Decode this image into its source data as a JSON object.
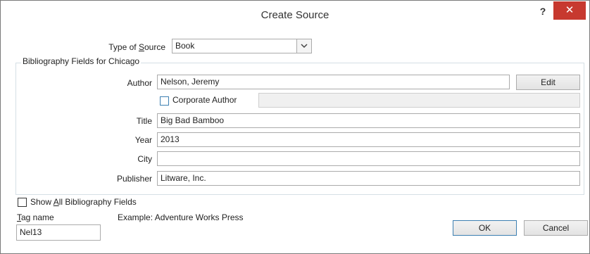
{
  "window": {
    "title": "Create Source",
    "help_label": "?",
    "close_label": "✕"
  },
  "type_of_source": {
    "label_pre": "Type of ",
    "label_ul": "S",
    "label_post": "ource",
    "value": "Book"
  },
  "group": {
    "title": "Bibliography Fields for Chicago"
  },
  "author": {
    "label": "Author",
    "value": "Nelson, Jeremy",
    "edit_label": "Edit"
  },
  "corporate_author": {
    "label": "Corporate Author",
    "checked": false,
    "value": ""
  },
  "fields": {
    "title_label": "Title",
    "title_value": "Big Bad Bamboo",
    "year_label": "Year",
    "year_value": "2013",
    "city_label": "City",
    "city_value": "",
    "publisher_label": "Publisher",
    "publisher_value": "Litware, Inc."
  },
  "show_all": {
    "label_pre": "Show ",
    "label_ul": "A",
    "label_post": "ll Bibliography Fields",
    "checked": false
  },
  "tag": {
    "label_ul": "T",
    "label_post": "ag name",
    "value": "Nel13",
    "example": "Example: Adventure Works Press"
  },
  "buttons": {
    "ok": "OK",
    "cancel": "Cancel"
  }
}
